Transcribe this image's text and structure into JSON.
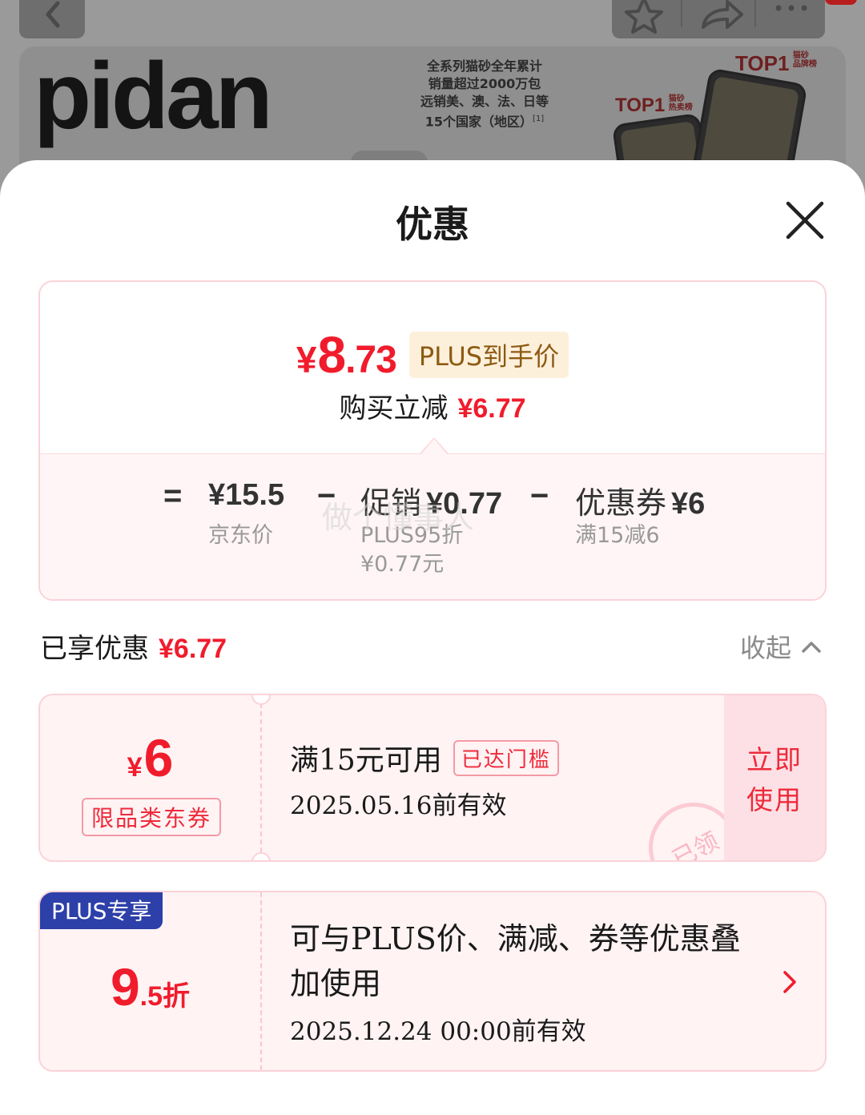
{
  "background": {
    "brand": "pidan",
    "brand_note_lines": [
      "全系列猫砂全年累计",
      "销量超过2000万包",
      "远销美、澳、法、日等",
      "15个国家（地区）"
    ],
    "brand_note_ref": "[1]",
    "badges": [
      {
        "main": "TOP1",
        "sub1": "猫砂",
        "sub2": "品牌榜"
      },
      {
        "main": "TOP1",
        "sub1": "猫砂",
        "sub2": "热卖榜"
      }
    ]
  },
  "sheet": {
    "title": "优惠"
  },
  "price_card": {
    "final_price": {
      "currency": "¥",
      "integer": "8",
      "decimal": ".73"
    },
    "plus_tag": "PLUS到手价",
    "saved_label": "购买立减",
    "saved_amount": "¥6.77",
    "watermark": "做个懂事人",
    "breakdown": {
      "equals": "=",
      "minus": "−",
      "jd_price": {
        "value": "¥15.5",
        "label": "京东价"
      },
      "promotion": {
        "label": "促销",
        "value": "¥0.77",
        "detail_1": "PLUS95折",
        "detail_2": "¥0.77元"
      },
      "coupon": {
        "label": "优惠券",
        "value": "¥6",
        "detail": "满15减6"
      }
    }
  },
  "enjoyed": {
    "label": "已享优惠",
    "amount": "¥6.77",
    "collapse_label": "收起"
  },
  "coupons": [
    {
      "currency": "¥",
      "value": "6",
      "type": "限品类东券",
      "condition": "满15元可用",
      "status_tag": "已达门槛",
      "validity": "2025.05.16前有效",
      "action": [
        "立即",
        "使用"
      ],
      "stamp": "已领"
    },
    {
      "badge": "PLUS专享",
      "discount_big": "9",
      "discount_small": ".5折",
      "description": "可与PLUS价、满减、券等优惠叠加使用",
      "validity": "2025.12.24 00:00前有效"
    }
  ],
  "colors": {
    "accent_red": "#f01c2c",
    "plus_blue": "#2d3fa8",
    "plus_gold_text": "#8d5a12",
    "plus_gold_bg": "#fdf0db"
  }
}
